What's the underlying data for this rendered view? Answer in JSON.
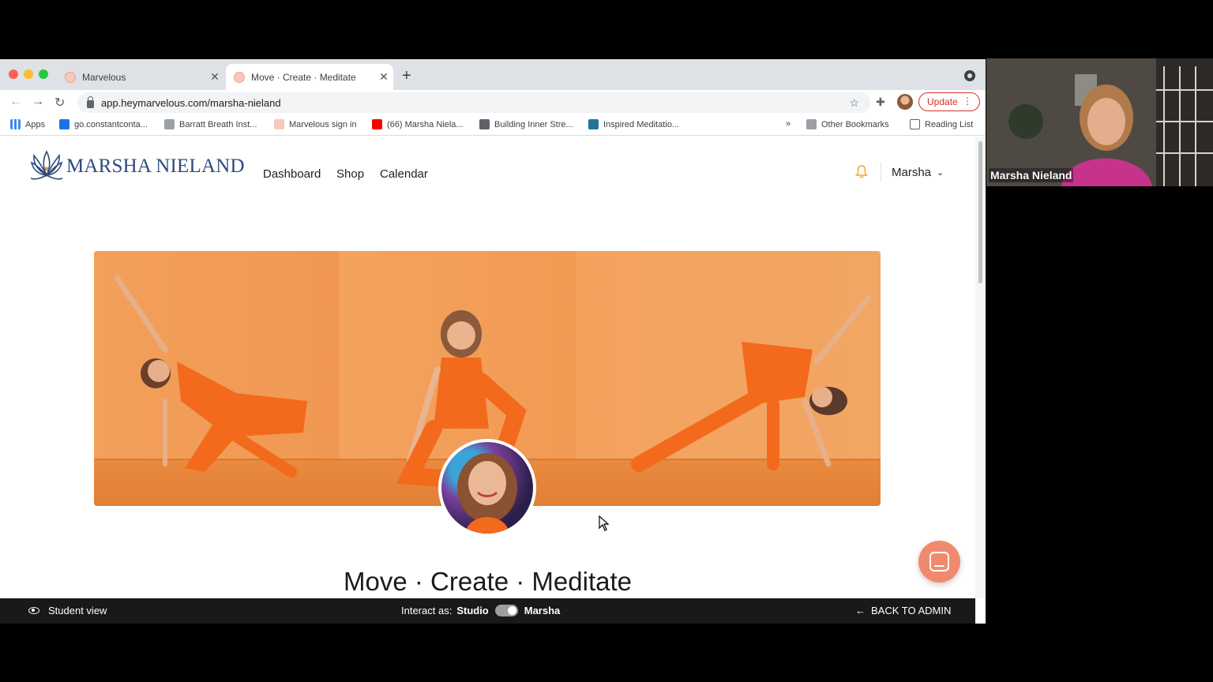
{
  "browser": {
    "tabs": [
      {
        "title": "Marvelous",
        "active": false
      },
      {
        "title": "Move · Create · Meditate",
        "active": true
      }
    ],
    "url": "app.heymarvelous.com/marsha-nieland",
    "update_label": "Update",
    "bookmarks": [
      {
        "label": "Apps",
        "icon": "apps-grid-icon"
      },
      {
        "label": "go.constantconta...",
        "icon": "constant-contact-icon"
      },
      {
        "label": "Barratt Breath Inst...",
        "icon": "barratt-icon"
      },
      {
        "label": "Marvelous sign in",
        "icon": "marvelous-icon"
      },
      {
        "label": "(66) Marsha Niela...",
        "icon": "youtube-icon"
      },
      {
        "label": "Building Inner Stre...",
        "icon": "globe-icon"
      },
      {
        "label": "Inspired Meditatio...",
        "icon": "wordpress-icon"
      }
    ],
    "bookmarks_overflow": "»",
    "other_bookmarks": "Other Bookmarks",
    "reading_list": "Reading List"
  },
  "site": {
    "brand": "MARSHA NIELAND",
    "nav": [
      "Dashboard",
      "Shop",
      "Calendar"
    ],
    "user": "Marsha",
    "headline": "Move · Create · Meditate",
    "brand_color": "#2d4a7a",
    "accent_color": "#f08a6e"
  },
  "adminbar": {
    "student_view": "Student view",
    "interact_as": "Interact as:",
    "studio": "Studio",
    "person": "Marsha",
    "back": "BACK TO ADMIN"
  },
  "video": {
    "participant": "Marsha Nieland"
  }
}
